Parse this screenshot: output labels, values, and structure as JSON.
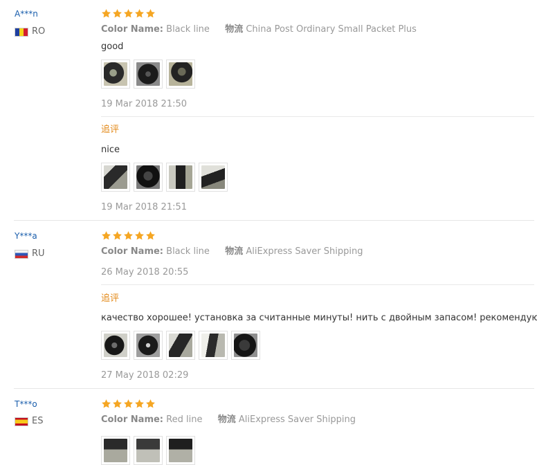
{
  "reviews": [
    {
      "user": "A***n",
      "country": "RO",
      "rating": 5,
      "color_label": "Color Name:",
      "color_value": "Black line",
      "shipping_label": "物流",
      "shipping_value": "China Post Ordinary Small Packet Plus",
      "text": "good",
      "date": "19 Mar 2018 21:50",
      "followup": {
        "label": "追评",
        "text": "nice",
        "date": "19 Mar 2018 21:51"
      }
    },
    {
      "user": "Y***a",
      "country": "RU",
      "rating": 5,
      "color_label": "Color Name:",
      "color_value": "Black line",
      "shipping_label": "物流",
      "shipping_value": "AliExpress Saver Shipping",
      "date": "26 May 2018 20:55",
      "followup": {
        "label": "追评",
        "text": "качество хорошее! установка за считанные минуты! нить с двойным запасом! рекомендую!",
        "date": "27 May 2018 02:29"
      }
    },
    {
      "user": "T***o",
      "country": "ES",
      "rating": 5,
      "color_label": "Color Name:",
      "color_value": "Red line",
      "shipping_label": "物流",
      "shipping_value": "AliExpress Saver Shipping"
    }
  ],
  "colors": {
    "username": "#1a5eac",
    "star": "#f5a623",
    "followup_label": "#e38a1a",
    "muted": "#999999"
  }
}
